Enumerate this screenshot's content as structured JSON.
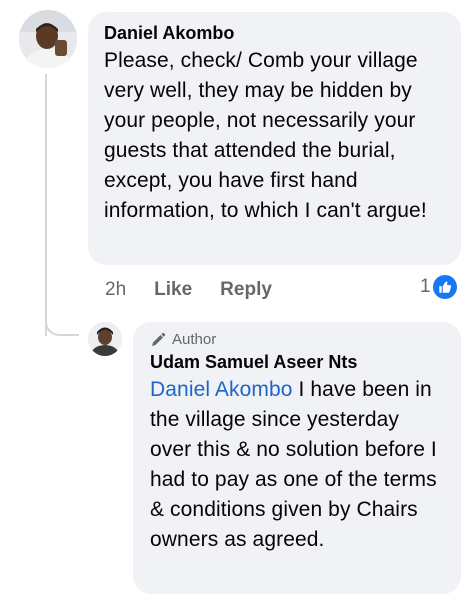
{
  "comment": {
    "author": "Daniel Akombo",
    "text": "Please, check/ Comb your village very well, they may be hidden by your people, not necessarily your guests that attended the burial, except, you have first hand information, to which I can't argue!",
    "timestamp": "2h",
    "like_label": "Like",
    "reply_label": "Reply",
    "reaction_count": "1",
    "reaction_icon": "like-icon",
    "avatar_icon": "profile-photo"
  },
  "reply": {
    "badge": "Author",
    "badge_icon": "pen-icon",
    "author": "Udam Samuel Aseer Nts",
    "mention": "Daniel Akombo",
    "text": " I have been in the village since yesterday over this & no solution before I had to pay as one of the terms & conditions given by Chairs owners as agreed.",
    "avatar_icon": "profile-photo"
  },
  "colors": {
    "bubble_bg": "#f0f2f5",
    "mention": "#1c65c8",
    "meta_text": "#65676b",
    "like_blue": "#1877f2"
  }
}
